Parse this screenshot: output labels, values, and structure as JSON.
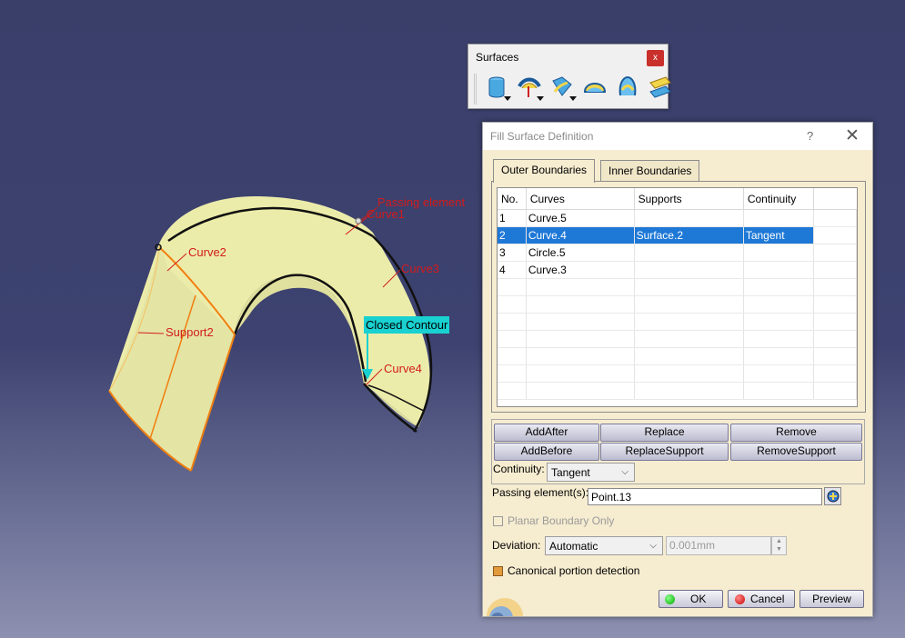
{
  "viewport": {
    "labels": {
      "passing_element": "Passing element",
      "curve1": "Curve1",
      "curve2": "Curve2",
      "curve3": "Curve3",
      "curve4": "Curve4",
      "support2": "Support2",
      "closed_contour": "Closed Contour"
    },
    "colors": {
      "surface": "#ececaa",
      "edge_highlight": "#f07f10",
      "annotation": "#d21c1c",
      "contour_tag": "#19d1d1"
    }
  },
  "toolbar": {
    "title": "Surfaces",
    "close_label": "x",
    "icons": [
      "extrude-surface-icon",
      "offset-surface-icon",
      "sweep-surface-icon",
      "fill-surface-icon",
      "multi-section-surface-icon",
      "blend-surface-icon"
    ]
  },
  "dialog": {
    "title": "Fill Surface Definition",
    "help_label": "?",
    "close_label": "✕",
    "tabs": [
      "Outer Boundaries",
      "Inner Boundaries"
    ],
    "columns": [
      "No.",
      "Curves",
      "Supports",
      "Continuity"
    ],
    "rows": [
      {
        "no": "1",
        "curve": "Curve.5",
        "support": "",
        "continuity": ""
      },
      {
        "no": "2",
        "curve": "Curve.4",
        "support": "Surface.2",
        "continuity": "Tangent"
      },
      {
        "no": "3",
        "curve": "Circle.5",
        "support": "",
        "continuity": ""
      },
      {
        "no": "4",
        "curve": "Curve.3",
        "support": "",
        "continuity": ""
      }
    ],
    "selected_row": 2,
    "buttons": {
      "add_after": "AddAfter",
      "replace": "Replace",
      "remove": "Remove",
      "add_before": "AddBefore",
      "replace_support": "ReplaceSupport",
      "remove_support": "RemoveSupport"
    },
    "continuity_label": "Continuity:",
    "continuity_value": "Tangent",
    "passing_label": "Passing element(s):",
    "passing_value": "Point.13",
    "planar_label": "Planar Boundary Only",
    "planar_checked": false,
    "deviation_label": "Deviation:",
    "deviation_mode": "Automatic",
    "deviation_value": "0.001mm",
    "canonical_label": "Canonical portion detection",
    "canonical_checked": true,
    "ok_label": "OK",
    "cancel_label": "Cancel",
    "preview_label": "Preview"
  }
}
